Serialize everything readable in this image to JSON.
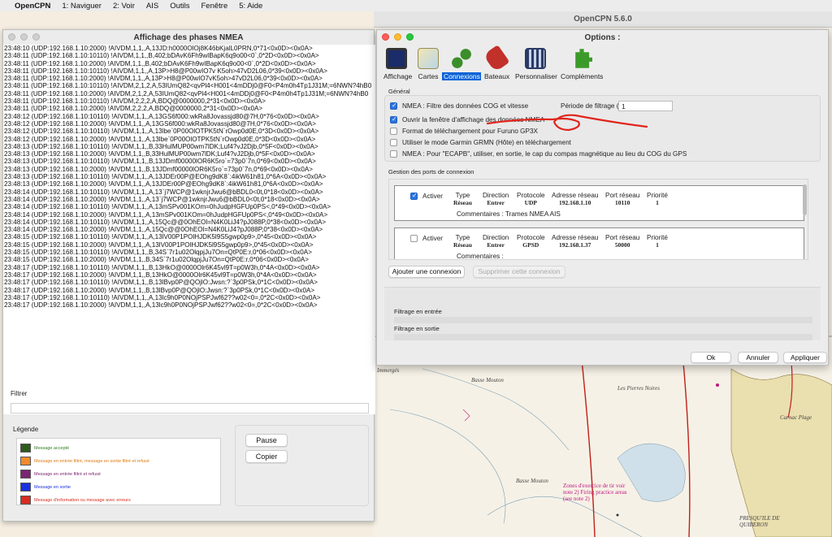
{
  "menubar": {
    "app": "OpenCPN",
    "items": [
      "1: Naviguer",
      "2: Voir",
      "AIS",
      "Outils",
      "Fenêtre",
      "5: Aide"
    ]
  },
  "main_window": {
    "title": "OpenCPN 5.6.0"
  },
  "nmea_window": {
    "title": "Affichage des phases NMEA",
    "log": [
      "23:48:10 (UDP:192.168.1.10:2000) !AIVDM,1,1,,A,13JD:h0000OlOj8K46bKjalL0PRN,0*71<0x0D><0x0A>",
      "23:48:11 (UDP:192.168.1.10:10110) !AIVDM,1,1,,B,402;bDAvK6Fh9wIBapK6q9o00<0`,0*2D<0x0D><0x0A>",
      "23:48:11 (UDP:192.168.1.10:2000) !AIVDM,1,1,,B,402;bDAvK6Fh9wIBapK6q9o00<0`,0*2D<0x0D><0x0A>",
      "23:48:11 (UDP:192.168.1.10:10110) !AIVDM,1,1,,A,13P>H8@P00wIO7v K5oh>47vD2L06,0*39<0x0D><0x0A>",
      "23:48:11 (UDP:192.168.1.10:2000) !AIVDM,1,1,,A,13P>H8@P00wIO7vK5oh>47vD2L06,0*39<0x0D><0x0A>",
      "23:48:11 (UDP:192.168.1.10:10110) !AIVDM,2,1,2,A,53IUmQ82<qvPl4<H001<4mDDj0@F0<P4m0h4Tp1J31M;=6NWN?4hB0",
      "23:48:11 (UDP:192.168.1.10:2000) !AIVDM,2,1,2,A,53IUmQ82<qvPl4<H001<4mDDj0@F0<P4m0h4Tp1J31M;=6NWN?4hB0",
      "23:48:11 (UDP:192.168.1.10:10110) !AIVDM,2,2,2,A,BDQ@0000000,2*31<0x0D><0x0A>",
      "23:48:11 (UDP:192.168.1.10:2000) !AIVDM,2,2,2,A,BDQ@0000000,2*31<0x0D><0x0A>",
      "23:48:12 (UDP:192.168.1.10:10110) !AIVDM,1,1,,A,13GS6f000:wkRa8Jovassjd80@7H,0*76<0x0D><0x0A>",
      "23:48:12 (UDP:192.168.1.10:2000) !AIVDM,1,1,,A,13GS6f000:wkRa8Jovassjd80@7H,0*76<0x0D><0x0A>",
      "23:48:12 (UDP:192.168.1.10:10110) !AIVDM,1,1,,A,13lbe`0P00OlOTPK5tN`rOwp0d0E,0*3D<0x0D><0x0A>",
      "23:48:12 (UDP:192.168.1.10:2000) !AIVDM,1,1,,A,13lbe`0P00OlOTPK5tN`rOwp0d0E,0*3D<0x0D><0x0A>",
      "23:48:13 (UDP:192.168.1.10:10110) !AIVDM,1,1,,B,33HulMUP00wm7lDK;Luf4?vJ2Djb,0*5F<0x0D><0x0A>",
      "23:48:13 (UDP:192.168.1.10:2000) !AIVDM,1,1,,B,33HulMUP00wm7lDK;Luf4?vJ2Djb,0*5F<0x0D><0x0A>",
      "23:48:13 (UDP:192.168.1.10:10110) !AIVDM,1,1,,B,13JDmf00000lOR6K5ro`=73p0`7n,0*69<0x0D><0x0A>",
      "23:48:13 (UDP:192.168.1.10:2000) !AIVDM,1,1,,B,13JDmf00000lOR6K5ro`=73p0`7n,0*69<0x0D><0x0A>",
      "23:48:13 (UDP:192.168.1.10:10110) !AIVDM,1,1,,A,13JDEr00P@EOhg9dK8`:4ikW61h81,0*6A<0x0D><0x0A>",
      "23:48:13 (UDP:192.168.1.10:2000) !AIVDM,1,1,,A,13JDEr00P@EOhg9dK8`:4ikW61h81,0*6A<0x0D><0x0A>",
      "23:48:14 (UDP:192.168.1.10:10110) !AIVDM,1,1,,A,13`j7WCP@1wknjrJwu6@bBDL0<0t,0*18<0x0D><0x0A>",
      "23:48:14 (UDP:192.168.1.10:2000) !AIVDM,1,1,,A,13`j7WCP@1wknjrJwu6@bBDL0<0t,0*18<0x0D><0x0A>",
      "23:48:14 (UDP:192.168.1.10:10110) !AIVDM,1,1,,A,13mSPv001KOm=0hJudpHGFUp0PS<,0*49<0x0D><0x0A>",
      "23:48:14 (UDP:192.168.1.10:2000) !AIVDM,1,1,,A,13mSPv001KOm=0hJudpHGFUp0PS<,0*49<0x0D><0x0A>",
      "23:48:14 (UDP:192.168.1.10:10110) !AIVDM,1,1,,A,15Qc@@0OhEOl=N4K0LiJ4?pJ088P,0*38<0x0D><0x0A>",
      "23:48:14 (UDP:192.168.1.10:2000) !AIVDM,1,1,,A,15Qc@@0OhEOl=N4K0LiJ4?pJ088P,0*38<0x0D><0x0A>",
      "23:48:15 (UDP:192.168.1.10:10110) !AIVDM,1,1,,A,13lV00P1POlHJDK5l9S5gwp0p9>,0*45<0x0D><0x0A>",
      "23:48:15 (UDP:192.168.1.10:2000) !AIVDM,1,1,,A,13lV00P1POlHJDK5l9S5gwp0p9>,0*45<0x0D><0x0A>",
      "23:48:15 (UDP:192.168.1.10:10110) !AIVDM,1,1,,B,34S`7r1u02OlqpjJu7On=QtP0E:r,0*06<0x0D><0x0A>",
      "23:48:15 (UDP:192.168.1.10:2000) !AIVDM,1,1,,B,34S`7r1u02OlqpjJu7On=QtP0E:r,0*06<0x0D><0x0A>",
      "23:48:17 (UDP:192.168.1.10:10110) !AIVDM,1,1,,B,13HkO@0000Olr6K45vl9T=p0W3h,0*4A<0x0D><0x0A>",
      "23:48:17 (UDP:192.168.1.10:2000) !AIVDM,1,1,,B,13HkO@0000Olr6K45vl9T=p0W3h,0*4A<0x0D><0x0A>",
      "23:48:17 (UDP:192.168.1.10:10110) !AIVDM,1,1,,B,13lBvp0P@QOjlO:Jwsn:?`3p0PSk,0*1C<0x0D><0x0A>",
      "23:48:17 (UDP:192.168.1.10:2000) !AIVDM,1,1,,B,13lBvp0P@QOjlO:Jwsn:?`3p0PSk,0*1C<0x0D><0x0A>",
      "23:48:17 (UDP:192.168.1.10:10110) !AIVDM,1,1,,A,13lc9h0P0NOjPSPJwf62??w02<0=,0*2C<0x0D><0x0A>",
      "23:48:17 (UDP:192.168.1.10:2000) !AIVDM,1,1,,A,13lc9h0P0NOjPSPJwf62??w02<0=,0*2C<0x0D><0x0A>"
    ],
    "filter_label": "Filtrer",
    "legend_label": "Légende",
    "legend": [
      {
        "text": "Message accepté",
        "color": "#2e5a1e",
        "text_color": "#2e7d1e"
      },
      {
        "text": "Message en entrée filtré, message en sortie filtré et refusé",
        "color": "#f08a2c",
        "text_color": "#e07a10"
      },
      {
        "text": "Message en entrée filtré et refusé",
        "color": "#7b2470",
        "text_color": "#7b2470"
      },
      {
        "text": "Message en sortie",
        "color": "#1a2fe0",
        "text_color": "#1a2fe0"
      },
      {
        "text": "Message d'information ou message avec erreurs",
        "color": "#d92b1f",
        "text_color": "#d92b1f"
      }
    ],
    "pause_label": "Pause",
    "copy_label": "Copier"
  },
  "options": {
    "title": "Options :",
    "toolbar": [
      {
        "label": "Affichage",
        "icon": "monitor-icon"
      },
      {
        "label": "Cartes",
        "icon": "charts-icon"
      },
      {
        "label": "Connexions",
        "icon": "connections-icon"
      },
      {
        "label": "Bateaux",
        "icon": "ships-icon"
      },
      {
        "label": "Personnaliser",
        "icon": "customize-icon"
      },
      {
        "label": "Compléments",
        "icon": "plugins-icon"
      }
    ],
    "general_label": "Général",
    "checks": [
      {
        "label": "NMEA : Filtre des données COG et vitesse",
        "checked": true
      },
      {
        "label": "Ouvrir la fenêtre d'affichage des données NMEA",
        "checked": true
      },
      {
        "label": "Format de téléchargement pour Furuno GP3X",
        "checked": false
      },
      {
        "label": "Utiliser le mode Garmin GRMN (Hôte) en téléchargement",
        "checked": false
      },
      {
        "label": "NMEA : Pour \"ECAPB\", utiliser, en sortie, le cap du compas magnétique  au lieu du COG du GPS",
        "checked": false
      }
    ],
    "period_label": "Période de filtrage (sec.)",
    "period_value": "1",
    "ports_label": "Gestion des ports de connexion",
    "headers": {
      "active": "Activer",
      "type": "Type",
      "direction": "Direction",
      "protocol": "Protocole",
      "address": "Adresse réseau",
      "port": "Port réseau",
      "priority": "Priorité",
      "comments": "Commentaires :"
    },
    "connections": [
      {
        "active": true,
        "type": "Réseau",
        "direction": "Entrer",
        "protocol": "UDP",
        "address": "192.168.1.10",
        "port": "10110",
        "priority": "1",
        "comment": "Commentaires : Trames NMEA AIS"
      },
      {
        "active": false,
        "type": "Réseau",
        "direction": "Entrer",
        "protocol": "GPSD",
        "address": "192.168.1.37",
        "port": "50000",
        "priority": "1",
        "comment": "Commentaires :"
      }
    ],
    "add_connection": "Ajouter une connexion",
    "delete_connection": "Supprimer cette connexion",
    "filter_in": "Filtrage en entrée",
    "filter_out": "Filtrage en sortie",
    "ok": "Ok",
    "cancel": "Annuler",
    "apply": "Appliquer"
  },
  "chart_labels": [
    "Immergés",
    "Basse Mouton",
    "Les Pierres Noires",
    "Zones d'exercice de tir voir note 2) Firing practice areas (see note 2)",
    "Basse Mouton",
    "Carnac Plage",
    "PRESQU'ILE DE QUIBERON"
  ]
}
